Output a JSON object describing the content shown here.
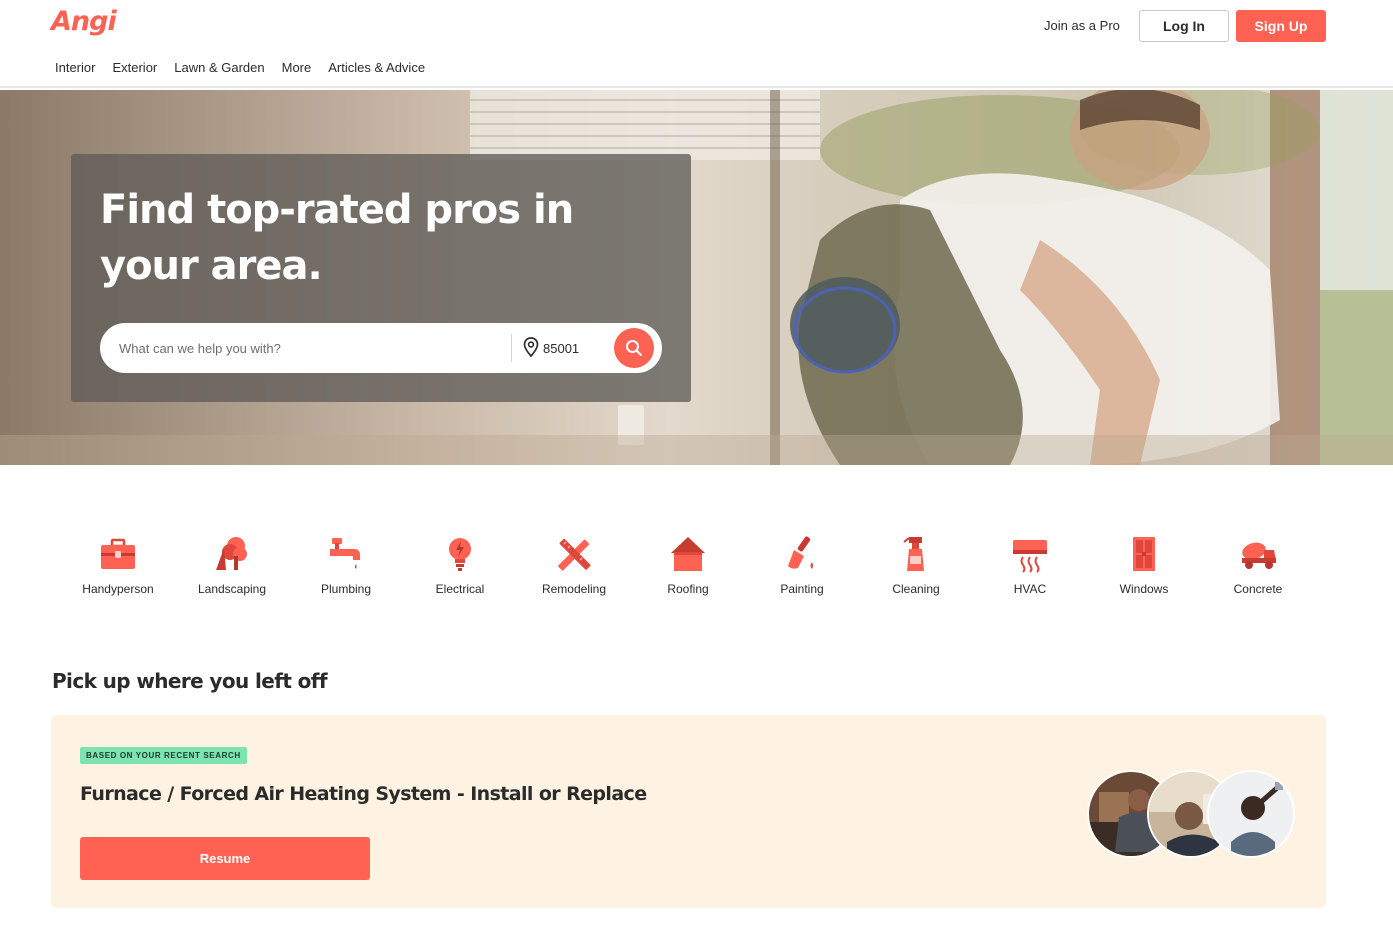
{
  "header": {
    "logo": "Angi",
    "nav": [
      "Interior",
      "Exterior",
      "Lawn & Garden",
      "More",
      "Articles & Advice"
    ],
    "join_pro": "Join as a Pro",
    "login": "Log In",
    "signup": "Sign Up"
  },
  "hero": {
    "title": "Find top-rated pros in your area.",
    "search_placeholder": "What can we help you with?",
    "zip_value": "85001"
  },
  "categories": [
    {
      "label": "Handyperson",
      "icon": "toolbox-icon"
    },
    {
      "label": "Landscaping",
      "icon": "tree-icon"
    },
    {
      "label": "Plumbing",
      "icon": "faucet-icon"
    },
    {
      "label": "Electrical",
      "icon": "lightbulb-icon"
    },
    {
      "label": "Remodeling",
      "icon": "ruler-pencil-icon"
    },
    {
      "label": "Roofing",
      "icon": "house-icon"
    },
    {
      "label": "Painting",
      "icon": "paintbrush-icon"
    },
    {
      "label": "Cleaning",
      "icon": "spray-bottle-icon"
    },
    {
      "label": "HVAC",
      "icon": "air-conditioner-icon"
    },
    {
      "label": "Windows",
      "icon": "window-icon"
    },
    {
      "label": "Concrete",
      "icon": "cement-mixer-icon"
    }
  ],
  "resume": {
    "section_title": "Pick up where you left off",
    "badge": "BASED ON YOUR RECENT SEARCH",
    "title": "Furnace / Forced Air Heating System - Install or Replace",
    "button": "Resume"
  },
  "colors": {
    "brand": "#ff6153",
    "badge_bg": "#7de3b0",
    "card_bg": "#fef3e2"
  }
}
